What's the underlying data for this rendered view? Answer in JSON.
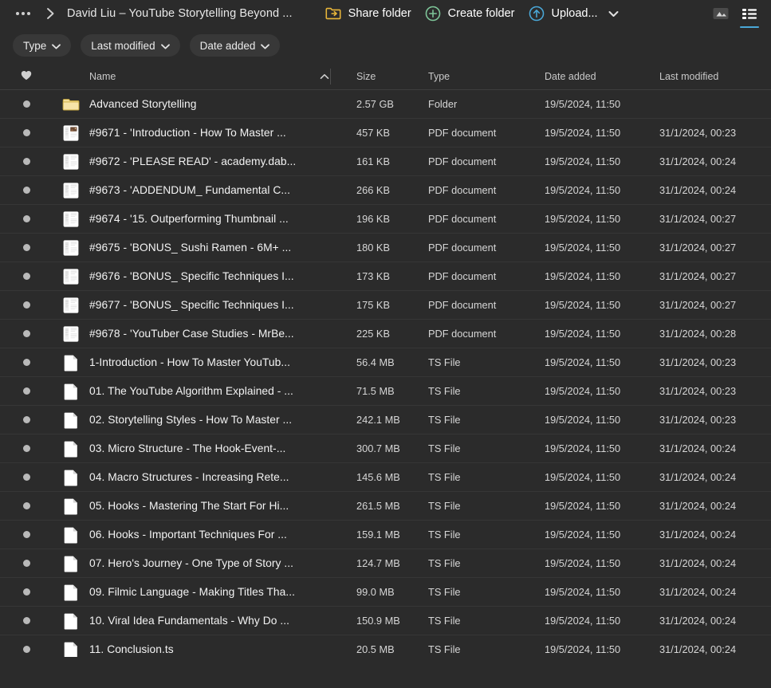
{
  "topbar": {
    "overflow_menu": "more-options",
    "breadcrumb_title": "David Liu – YouTube Storytelling Beyond ...",
    "share_label": "Share folder",
    "create_label": "Create folder",
    "upload_label": "Upload...",
    "gallery_view": "gallery-view",
    "list_view": "list-view",
    "accent_blue": "#4aa8d8",
    "share_icon_color": "#e8b63a",
    "create_icon_color": "#7fc79a",
    "upload_icon_color": "#4aa8d8"
  },
  "filters": [
    {
      "label": "Type"
    },
    {
      "label": "Last modified"
    },
    {
      "label": "Date added"
    }
  ],
  "columns": {
    "favorite": "",
    "name": "Name",
    "size": "Size",
    "type": "Type",
    "date_added": "Date added",
    "last_modified": "Last modified",
    "sort": "ascending"
  },
  "files": [
    {
      "icon": "folder-icon",
      "name": "Advanced Storytelling",
      "size": "2.57 GB",
      "type": "Folder",
      "added": "19/5/2024, 11:50",
      "modified": ""
    },
    {
      "icon": "pdf-thumb-image-icon",
      "name": "#9671 - 'Introduction - How To Master ...",
      "size": "457 KB",
      "type": "PDF document",
      "added": "19/5/2024, 11:50",
      "modified": "31/1/2024, 00:23"
    },
    {
      "icon": "pdf-thumb-icon",
      "name": "#9672 - 'PLEASE READ' - academy.dab...",
      "size": "161 KB",
      "type": "PDF document",
      "added": "19/5/2024, 11:50",
      "modified": "31/1/2024, 00:24"
    },
    {
      "icon": "pdf-thumb-icon",
      "name": "#9673 - 'ADDENDUM_ Fundamental C...",
      "size": "266 KB",
      "type": "PDF document",
      "added": "19/5/2024, 11:50",
      "modified": "31/1/2024, 00:24"
    },
    {
      "icon": "pdf-thumb-icon",
      "name": "#9674 - '15. Outperforming Thumbnail ...",
      "size": "196 KB",
      "type": "PDF document",
      "added": "19/5/2024, 11:50",
      "modified": "31/1/2024, 00:27"
    },
    {
      "icon": "pdf-thumb-icon",
      "name": "#9675 - 'BONUS_ Sushi Ramen - 6M+ ...",
      "size": "180 KB",
      "type": "PDF document",
      "added": "19/5/2024, 11:50",
      "modified": "31/1/2024, 00:27"
    },
    {
      "icon": "pdf-thumb-icon",
      "name": "#9676 - 'BONUS_ Specific Techniques I...",
      "size": "173 KB",
      "type": "PDF document",
      "added": "19/5/2024, 11:50",
      "modified": "31/1/2024, 00:27"
    },
    {
      "icon": "pdf-thumb-icon",
      "name": "#9677 - 'BONUS_ Specific Techniques I...",
      "size": "175 KB",
      "type": "PDF document",
      "added": "19/5/2024, 11:50",
      "modified": "31/1/2024, 00:27"
    },
    {
      "icon": "pdf-thumb-icon",
      "name": "#9678 - 'YouTuber Case Studies - MrBe...",
      "size": "225 KB",
      "type": "PDF document",
      "added": "19/5/2024, 11:50",
      "modified": "31/1/2024, 00:28"
    },
    {
      "icon": "file-icon",
      "name": "1-Introduction - How To Master YouTub...",
      "size": "56.4 MB",
      "type": "TS File",
      "added": "19/5/2024, 11:50",
      "modified": "31/1/2024, 00:23"
    },
    {
      "icon": "file-icon",
      "name": "01. The YouTube Algorithm Explained - ...",
      "size": "71.5 MB",
      "type": "TS File",
      "added": "19/5/2024, 11:50",
      "modified": "31/1/2024, 00:23"
    },
    {
      "icon": "file-icon",
      "name": "02. Storytelling Styles - How To Master ...",
      "size": "242.1 MB",
      "type": "TS File",
      "added": "19/5/2024, 11:50",
      "modified": "31/1/2024, 00:23"
    },
    {
      "icon": "file-icon",
      "name": "03. Micro Structure - The Hook-Event-...",
      "size": "300.7 MB",
      "type": "TS File",
      "added": "19/5/2024, 11:50",
      "modified": "31/1/2024, 00:24"
    },
    {
      "icon": "file-icon",
      "name": "04. Macro Structures - Increasing Rete...",
      "size": "145.6 MB",
      "type": "TS File",
      "added": "19/5/2024, 11:50",
      "modified": "31/1/2024, 00:24"
    },
    {
      "icon": "file-icon",
      "name": "05. Hooks - Mastering The Start For Hi...",
      "size": "261.5 MB",
      "type": "TS File",
      "added": "19/5/2024, 11:50",
      "modified": "31/1/2024, 00:24"
    },
    {
      "icon": "file-icon",
      "name": "06. Hooks - Important Techniques For ...",
      "size": "159.1 MB",
      "type": "TS File",
      "added": "19/5/2024, 11:50",
      "modified": "31/1/2024, 00:24"
    },
    {
      "icon": "file-icon",
      "name": "07. Hero's Journey - One Type of Story ...",
      "size": "124.7 MB",
      "type": "TS File",
      "added": "19/5/2024, 11:50",
      "modified": "31/1/2024, 00:24"
    },
    {
      "icon": "file-icon",
      "name": "09. Filmic Language - Making Titles Tha...",
      "size": "99.0 MB",
      "type": "TS File",
      "added": "19/5/2024, 11:50",
      "modified": "31/1/2024, 00:24"
    },
    {
      "icon": "file-icon",
      "name": "10. Viral Idea Fundamentals - Why Do ...",
      "size": "150.9 MB",
      "type": "TS File",
      "added": "19/5/2024, 11:50",
      "modified": "31/1/2024, 00:24"
    },
    {
      "icon": "file-icon",
      "name": "11. Conclusion.ts",
      "size": "20.5 MB",
      "type": "TS File",
      "added": "19/5/2024, 11:50",
      "modified": "31/1/2024, 00:24"
    }
  ]
}
